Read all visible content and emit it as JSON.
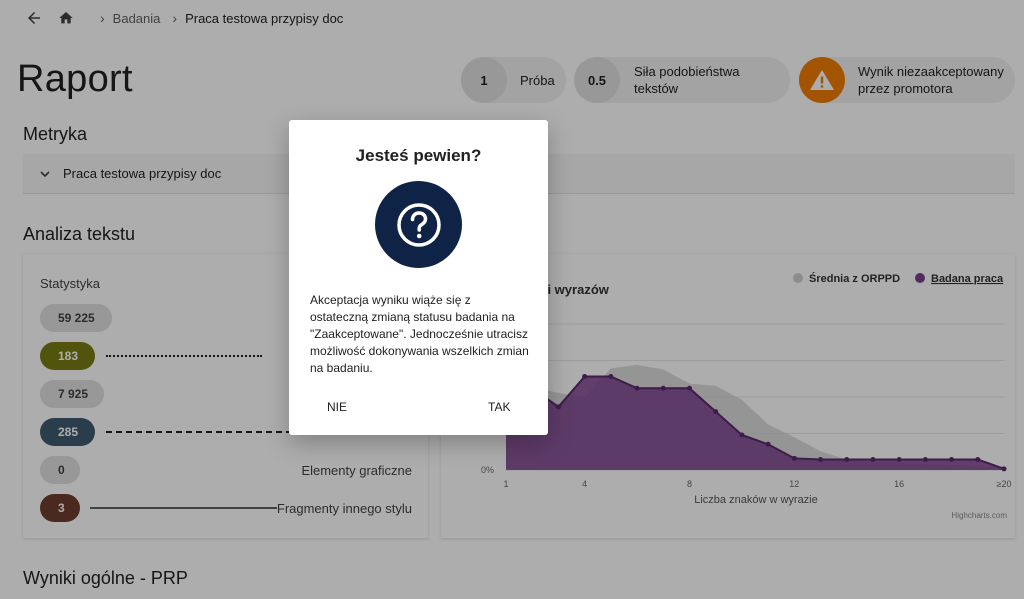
{
  "breadcrumb": {
    "items": [
      "Badania",
      "Praca testowa przypisy doc"
    ]
  },
  "page": {
    "title": "Raport"
  },
  "pills": [
    {
      "value": "1",
      "label": "Próba"
    },
    {
      "value": "0.5",
      "label_line1": "Siła podobieństwa",
      "label_line2": "tekstów"
    },
    {
      "icon": "warning-icon",
      "label_line1": "Wynik niezaakceptowany",
      "label_line2": "przez promotora",
      "icon_color": "#ef7d00"
    }
  ],
  "sections": {
    "metryka": "Metryka",
    "analiza": "Analiza tekstu",
    "wyniki": "Wyniki ogólne - PRP"
  },
  "metric_panel": {
    "label": "Praca testowa przypisy doc"
  },
  "stats": {
    "header": "Statystyka",
    "rows": [
      {
        "value": "59 225",
        "name": "",
        "color": "#e0e0e0",
        "text_color": "#424242"
      },
      {
        "value": "183",
        "name": "",
        "color": "#7a7b12",
        "text_color": "#ffffff"
      },
      {
        "value": "7 925",
        "name": "",
        "color": "#e0e0e0",
        "text_color": "#424242"
      },
      {
        "value": "285",
        "name": "",
        "color": "#3e5a6e",
        "text_color": "#ffffff"
      },
      {
        "value": "0",
        "name": "Elementy graficzne",
        "color": "#e0e0e0",
        "text_color": "#424242"
      },
      {
        "value": "3",
        "name": "Fragmenty innego stylu",
        "color": "#6d3f2d",
        "text_color": "#ffffff"
      }
    ]
  },
  "chart_data": {
    "type": "area",
    "title": "ści wyrazów",
    "xlabel": "Liczba znaków w wyrazie",
    "ylabel": "",
    "x_ticks": [
      "1",
      "4",
      "8",
      "12",
      "16",
      "≥20"
    ],
    "y_tick_bottom": "0%",
    "credit": "Highcharts.com",
    "legend": {
      "placement": "top-right"
    },
    "x": [
      1,
      2,
      3,
      4,
      5,
      6,
      7,
      8,
      9,
      10,
      11,
      12,
      13,
      14,
      15,
      16,
      17,
      18,
      19,
      20
    ],
    "series": [
      {
        "name": "Średnia z ORPPD",
        "color": "#d0d0d0",
        "values": [
          6.8,
          7.1,
          6.6,
          6.2,
          8.7,
          9.0,
          8.6,
          7.4,
          7.2,
          6.0,
          3.9,
          2.8,
          1.6,
          0.9,
          0.7,
          0.6,
          0.5,
          0.4,
          0.3,
          0.3
        ]
      },
      {
        "name": "Badana praca",
        "color": "#7b3f8e",
        "values": [
          6.5,
          7.0,
          5.4,
          8.0,
          8.0,
          7.0,
          7.0,
          7.0,
          5.0,
          3.0,
          2.2,
          1.0,
          0.9,
          0.9,
          0.9,
          0.9,
          0.9,
          0.9,
          0.9,
          0.1
        ]
      }
    ]
  },
  "modal": {
    "title": "Jesteś pewien?",
    "text": "Akceptacja wyniku wiąże się z ostateczną zmianą statusu badania na \"Zaakceptowane\". Jednocześnie utracisz możliwość dokonywania wszelkich zmian na badaniu.",
    "cancel": "NIE",
    "confirm": "TAK",
    "icon": "question-icon",
    "icon_bg": "#0f2347"
  }
}
